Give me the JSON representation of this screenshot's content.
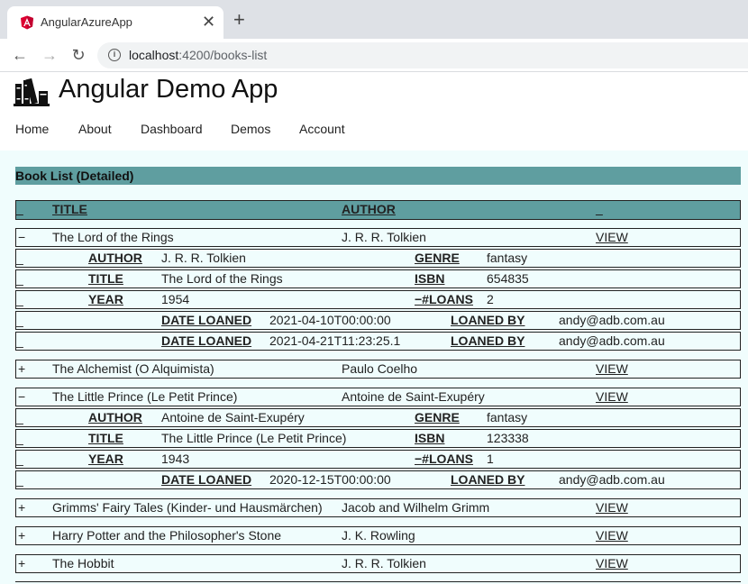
{
  "browser": {
    "tab_title": "AngularAzureApp",
    "url_host": "localhost",
    "url_path": ":4200/books-list"
  },
  "app": {
    "title": "Angular Demo App",
    "nav": [
      "Home",
      "About",
      "Dashboard",
      "Demos",
      "Account"
    ]
  },
  "section_title": "Book List (Detailed)",
  "table_header": {
    "toggle": "_",
    "title": "TITLE",
    "author": "AUTHOR",
    "action": "_"
  },
  "labels": {
    "author": "AUTHOR",
    "title": "TITLE",
    "year": "YEAR",
    "genre": "GENRE",
    "isbn": "ISBN",
    "loans": "−#LOANS",
    "date_loaned": "DATE LOANED",
    "loaned_by": "LOANED BY",
    "view": "VIEW",
    "detail_marker": "_",
    "expanded": "−",
    "collapsed": "+"
  },
  "books": [
    {
      "title": "The Lord of the Rings",
      "author": "J. R. R. Tolkien",
      "expanded": true,
      "genre": "fantasy",
      "isbn": "654835",
      "year": "1954",
      "loans": "2",
      "loan_records": [
        {
          "date": "2021-04-10T00:00:00",
          "by": "andy@adb.com.au"
        },
        {
          "date": "2021-04-21T11:23:25.1",
          "by": "andy@adb.com.au"
        }
      ]
    },
    {
      "title": "The Alchemist (O Alquimista)",
      "author": "Paulo Coelho",
      "expanded": false
    },
    {
      "title": "The Little Prince (Le Petit Prince)",
      "author": "Antoine de Saint-Exupéry",
      "expanded": true,
      "genre": "fantasy",
      "isbn": "123338",
      "year": "1943",
      "loans": "1",
      "loan_records": [
        {
          "date": "2020-12-15T00:00:00",
          "by": "andy@adb.com.au"
        }
      ]
    },
    {
      "title": "Grimms' Fairy Tales (Kinder- und Hausmärchen)",
      "author": "Jacob and Wilhelm Grimm",
      "expanded": false
    },
    {
      "title": "Harry Potter and the Philosopher's Stone",
      "author": "J. K. Rowling",
      "expanded": false
    },
    {
      "title": "The Hobbit",
      "author": "J. R. R. Tolkien",
      "expanded": false
    }
  ]
}
